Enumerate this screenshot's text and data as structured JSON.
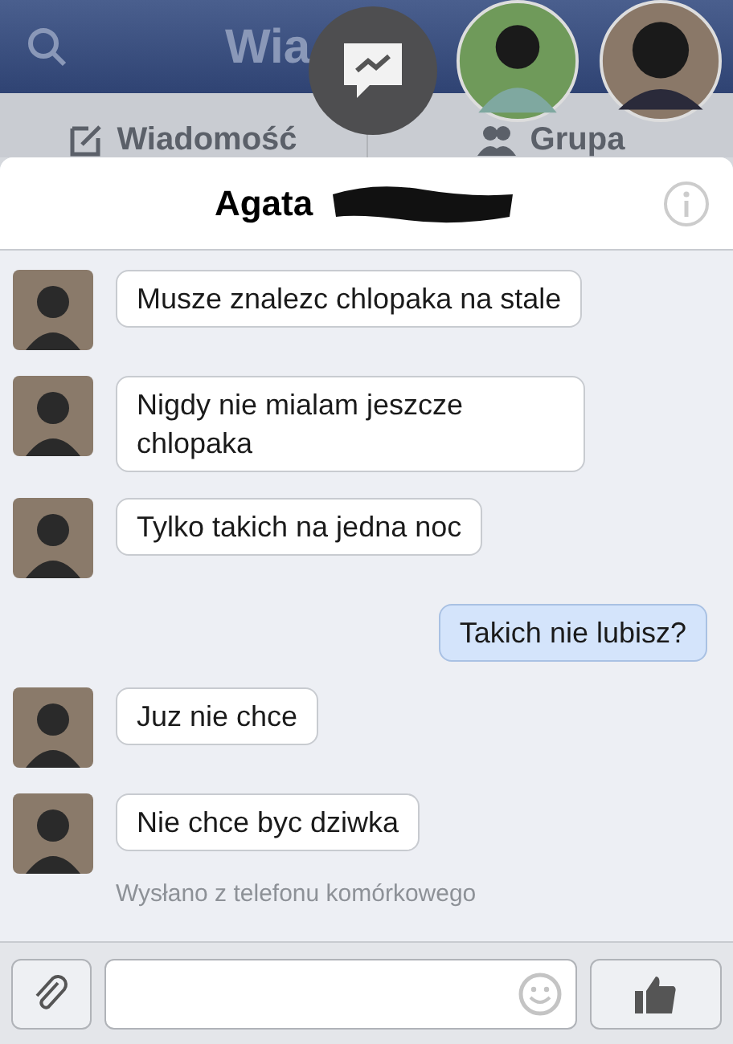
{
  "top_bar": {
    "title_visible": "Wia"
  },
  "tabs": [
    {
      "label": "Wiadomość",
      "kind": "compose"
    },
    {
      "label": "Grupa",
      "kind": "group"
    }
  ],
  "chat": {
    "contact_first_name": "Agata"
  },
  "messages": [
    {
      "text": "Musze znalezc chlopaka na stale",
      "outgoing": false
    },
    {
      "text": "Nigdy nie mialam jeszcze chlopaka",
      "outgoing": false
    },
    {
      "text": "Tylko takich na jedna noc",
      "outgoing": false
    },
    {
      "text": "Takich nie lubisz?",
      "outgoing": true
    },
    {
      "text": "Juz nie chce",
      "outgoing": false
    },
    {
      "text": "Nie chce byc dziwka",
      "outgoing": false
    }
  ],
  "status": "Wysłano z telefonu komórkowego"
}
